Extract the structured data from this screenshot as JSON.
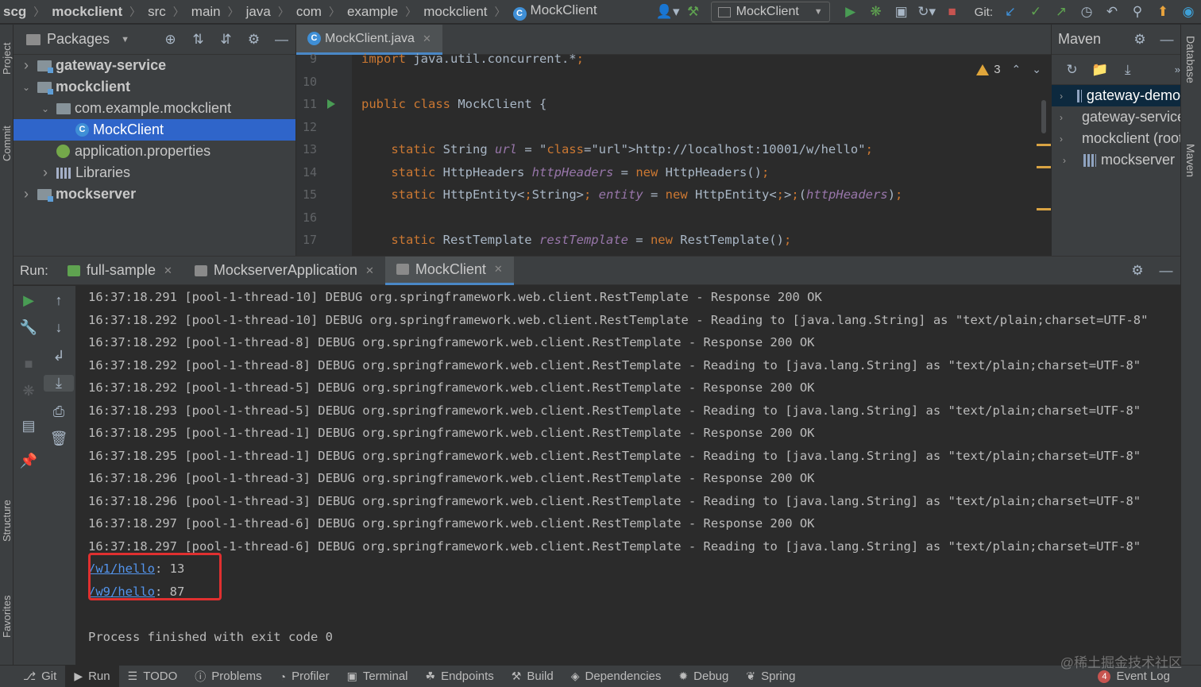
{
  "breadcrumb": [
    "scg",
    "mockclient",
    "src",
    "main",
    "java",
    "com",
    "example",
    "mockclient",
    "MockClient"
  ],
  "toolbar": {
    "run_config": "MockClient",
    "git_label": "Git:"
  },
  "project": {
    "view": "Packages",
    "tree": [
      {
        "label": "gateway-service",
        "bold": true,
        "expanded": false,
        "indent": 0,
        "kind": "module"
      },
      {
        "label": "mockclient",
        "bold": true,
        "expanded": true,
        "indent": 0,
        "kind": "module"
      },
      {
        "label": "com.example.mockclient",
        "bold": false,
        "expanded": true,
        "indent": 1,
        "kind": "package"
      },
      {
        "label": "MockClient",
        "bold": false,
        "expanded": null,
        "indent": 2,
        "kind": "class",
        "selected": true
      },
      {
        "label": "application.properties",
        "bold": false,
        "expanded": null,
        "indent": 1,
        "kind": "properties"
      },
      {
        "label": "Libraries",
        "bold": false,
        "expanded": false,
        "indent": 1,
        "kind": "library"
      },
      {
        "label": "mockserver",
        "bold": true,
        "expanded": false,
        "indent": 0,
        "kind": "module"
      }
    ]
  },
  "editor": {
    "tab": "MockClient.java",
    "warnings": "3",
    "lines": [
      {
        "n": "9",
        "t": "import java.util.concurrent.*;"
      },
      {
        "n": "10",
        "t": ""
      },
      {
        "n": "11",
        "t": "public class MockClient {"
      },
      {
        "n": "12",
        "t": ""
      },
      {
        "n": "13",
        "t": "    static String url = \"http://localhost:10001/w/hello\";"
      },
      {
        "n": "14",
        "t": "    static HttpHeaders httpHeaders = new HttpHeaders();"
      },
      {
        "n": "15",
        "t": "    static HttpEntity<String> entity = new HttpEntity<>(httpHeaders);"
      },
      {
        "n": "16",
        "t": ""
      },
      {
        "n": "17",
        "t": "    static RestTemplate restTemplate = new RestTemplate();"
      }
    ]
  },
  "maven": {
    "title": "Maven",
    "items": [
      "gateway-demo",
      "gateway-service",
      "mockclient (root)",
      "mockserver"
    ]
  },
  "side_tabs": {
    "project": "Project",
    "commit": "Commit",
    "structure": "Structure",
    "favorites": "Favorites",
    "database": "Database",
    "maven": "Maven"
  },
  "run": {
    "label": "Run:",
    "tabs": [
      "full-sample",
      "MockserverApplication",
      "MockClient"
    ],
    "active_tab": "MockClient",
    "console": [
      "16:37:18.291 [pool-1-thread-10] DEBUG org.springframework.web.client.RestTemplate - Response 200 OK",
      "16:37:18.292 [pool-1-thread-10] DEBUG org.springframework.web.client.RestTemplate - Reading to [java.lang.String] as \"text/plain;charset=UTF-8\"",
      "16:37:18.292 [pool-1-thread-8] DEBUG org.springframework.web.client.RestTemplate - Response 200 OK",
      "16:37:18.292 [pool-1-thread-8] DEBUG org.springframework.web.client.RestTemplate - Reading to [java.lang.String] as \"text/plain;charset=UTF-8\"",
      "16:37:18.292 [pool-1-thread-5] DEBUG org.springframework.web.client.RestTemplate - Response 200 OK",
      "16:37:18.293 [pool-1-thread-5] DEBUG org.springframework.web.client.RestTemplate - Reading to [java.lang.String] as \"text/plain;charset=UTF-8\"",
      "16:37:18.295 [pool-1-thread-1] DEBUG org.springframework.web.client.RestTemplate - Response 200 OK",
      "16:37:18.295 [pool-1-thread-1] DEBUG org.springframework.web.client.RestTemplate - Reading to [java.lang.String] as \"text/plain;charset=UTF-8\"",
      "16:37:18.296 [pool-1-thread-3] DEBUG org.springframework.web.client.RestTemplate - Response 200 OK",
      "16:37:18.296 [pool-1-thread-3] DEBUG org.springframework.web.client.RestTemplate - Reading to [java.lang.String] as \"text/plain;charset=UTF-8\"",
      "16:37:18.297 [pool-1-thread-6] DEBUG org.springframework.web.client.RestTemplate - Response 200 OK",
      "16:37:18.297 [pool-1-thread-6] DEBUG org.springframework.web.client.RestTemplate - Reading to [java.lang.String] as \"text/plain;charset=UTF-8\""
    ],
    "results": [
      {
        "path": "/w1/hello",
        "value": ": 13"
      },
      {
        "path": "/w9/hello",
        "value": ": 87"
      }
    ],
    "exit": "Process finished with exit code 0"
  },
  "bottom_tabs": [
    {
      "label": "Git",
      "icon": "git-icon"
    },
    {
      "label": "Run",
      "icon": "run-icon",
      "active": true
    },
    {
      "label": "TODO",
      "icon": "todo-icon"
    },
    {
      "label": "Problems",
      "icon": "problems-icon"
    },
    {
      "label": "Profiler",
      "icon": "profiler-icon"
    },
    {
      "label": "Terminal",
      "icon": "terminal-icon"
    },
    {
      "label": "Endpoints",
      "icon": "endpoints-icon"
    },
    {
      "label": "Build",
      "icon": "build-icon"
    },
    {
      "label": "Dependencies",
      "icon": "dependencies-icon"
    },
    {
      "label": "Debug",
      "icon": "debug-icon"
    },
    {
      "label": "Spring",
      "icon": "spring-icon"
    }
  ],
  "event_log": {
    "count": "4",
    "label": "Event Log"
  },
  "watermark": "@稀土掘金技术社区",
  "colors": {
    "accent": "#2f65ca",
    "tab_underline": "#4a88c7",
    "keyword": "#cc7832",
    "string": "#6a8759",
    "field": "#9876aa",
    "link": "#5394ec",
    "highlight_box": "#e03030"
  }
}
